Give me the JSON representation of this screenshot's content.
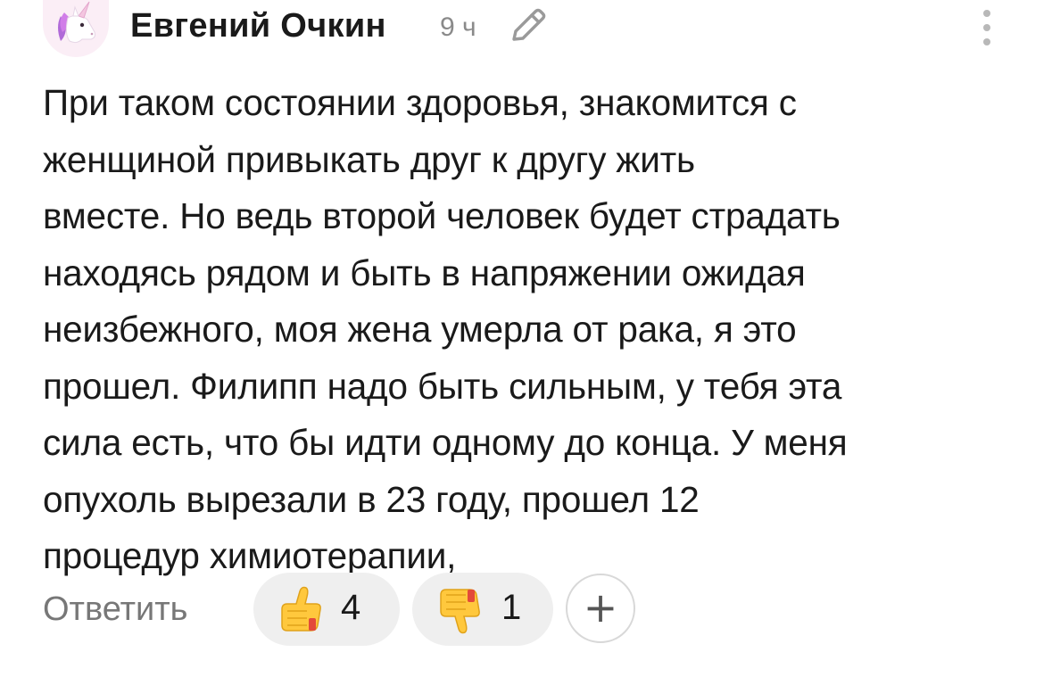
{
  "comment": {
    "author": "Евгений Очкин",
    "time": "9 ч",
    "avatar_icon": "unicorn-avatar",
    "edit_icon": "pencil-icon",
    "menu_icon": "more-vertical-icon",
    "text": "При таком состоянии здоровья, знакомится с\nженщиной привыкать друг к другу жить\nвместе. Но ведь второй человек будет страдать\nнаходясь рядом и быть в напряжении ожидая\nнеизбежного, моя жена умерла от рака, я это\nпрошел. Филипп надо быть сильным, у тебя эта\nсила есть, что бы идти одному до конца. У меня\nопухоль вырезали в 23 году, прошел 12\nпроцедур химиотерапии,"
  },
  "actions": {
    "reply_label": "Ответить",
    "reactions": [
      {
        "icon": "thumbs-up-icon",
        "count": "4"
      },
      {
        "icon": "thumbs-down-icon",
        "count": "1"
      }
    ],
    "add_reaction_icon": "plus-icon",
    "add_reaction_label": "+"
  },
  "colors": {
    "text": "#1a1a1a",
    "muted": "#8a8a8a",
    "pill_bg": "#efefef",
    "avatar_bg": "#fbeef6"
  }
}
